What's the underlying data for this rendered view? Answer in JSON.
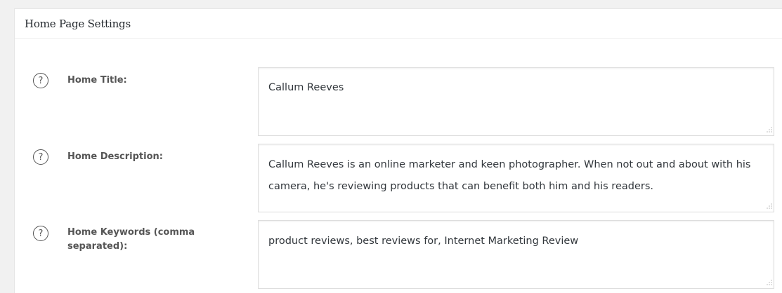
{
  "panel": {
    "title": "Home Page Settings"
  },
  "fields": [
    {
      "label": "Home Title:",
      "value": "Callum Reeves"
    },
    {
      "label": "Home Description:",
      "value": "Callum Reeves is an online marketer and keen photographer. When not out and about with his camera, he's reviewing products that can benefit both him and his readers."
    },
    {
      "label": "Home Keywords (comma separated):",
      "value": "product reviews, best reviews for, Internet Marketing Review"
    }
  ],
  "help_icon_glyph": "?",
  "colors": {
    "background": "#f1f1f1",
    "panel": "#ffffff",
    "border": "#dddddd",
    "label": "#555555",
    "text": "#32373c"
  }
}
